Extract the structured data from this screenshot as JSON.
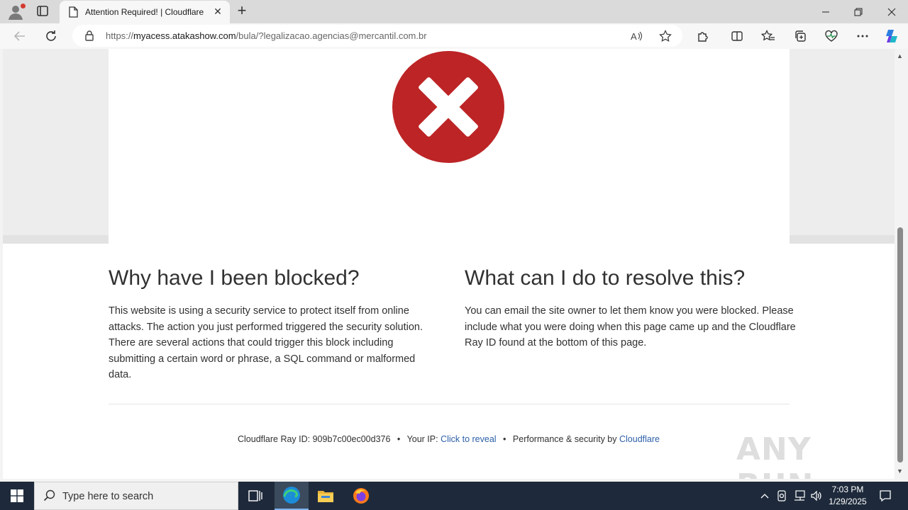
{
  "browser": {
    "tab_title": "Attention Required! | Cloudflare",
    "url_host": "myacess.atakashow.com",
    "url_path": "/bula/?legalizacao.agencias@mercantil.com.br",
    "url_scheme": "https://",
    "icons": {
      "profile": "profile-icon",
      "tab_actions": "tab-actions-icon",
      "back": "back-arrow-icon",
      "refresh": "refresh-icon",
      "lock": "lock-icon",
      "read_aloud": "read-aloud-icon",
      "favorite": "star-icon",
      "extensions": "puzzle-icon",
      "split_screen": "split-screen-icon",
      "favorites": "favorites-icon",
      "collections": "collections-icon",
      "performance": "heart-pulse-icon",
      "menu": "ellipsis-icon",
      "copilot": "copilot-icon"
    }
  },
  "page": {
    "left_heading": "Why have I been blocked?",
    "left_body": "This website is using a security service to protect itself from online attacks. The action you just performed triggered the security solution. There are several actions that could trigger this block including submitting a certain word or phrase, a SQL command or malformed data.",
    "right_heading": "What can I do to resolve this?",
    "right_body": "You can email the site owner to let them know you were blocked. Please include what you were doing when this page came up and the Cloudflare Ray ID found at the bottom of this page.",
    "footer": {
      "ray_label": "Cloudflare Ray ID:",
      "ray_id": "909b7c00ec00d376",
      "ip_label": "Your IP:",
      "ip_link": "Click to reveal",
      "perf_label": "Performance & security by",
      "cloudflare_link": "Cloudflare",
      "bullet": "•"
    },
    "watermark": "ANY RUN",
    "colors": {
      "error_red": "#bd2426",
      "link_blue": "#2c5fa8"
    }
  },
  "taskbar": {
    "search_placeholder": "Type here to search",
    "time": "7:03 PM",
    "date": "1/29/2025",
    "apps": [
      "task-view-icon",
      "edge-icon",
      "file-explorer-icon",
      "firefox-icon"
    ]
  }
}
